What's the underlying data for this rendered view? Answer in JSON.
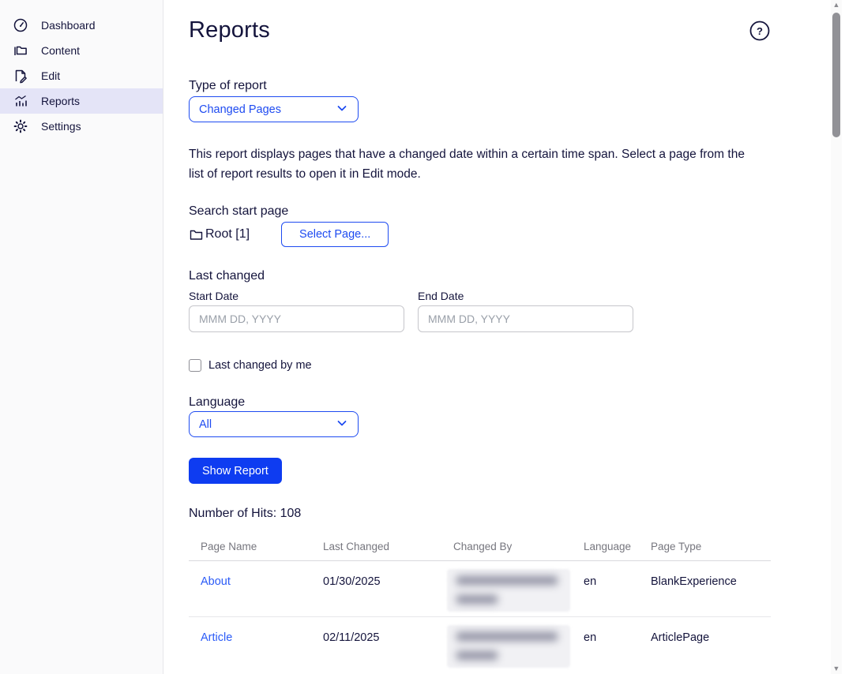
{
  "sidebar": {
    "items": [
      {
        "label": "Dashboard",
        "icon": "dashboard-gauge-icon",
        "selected": false
      },
      {
        "label": "Content",
        "icon": "content-folder-icon",
        "selected": false
      },
      {
        "label": "Edit",
        "icon": "edit-pencil-icon",
        "selected": false
      },
      {
        "label": "Reports",
        "icon": "reports-chart-icon",
        "selected": true
      },
      {
        "label": "Settings",
        "icon": "settings-gear-icon",
        "selected": false
      }
    ]
  },
  "header": {
    "title": "Reports",
    "help_icon": "help-circle-icon"
  },
  "form": {
    "type_of_report": {
      "label": "Type of report",
      "value": "Changed Pages"
    },
    "description": "This report displays pages that have a changed date within a certain time span. Select a page from the list of report results to open it in Edit mode.",
    "search_start_page": {
      "label": "Search start page",
      "root_icon": "folder-icon",
      "root_label": "Root [1]",
      "select_page_button": "Select Page..."
    },
    "last_changed": {
      "label": "Last changed",
      "start_date": {
        "label": "Start Date",
        "placeholder": "MMM DD, YYYY",
        "value": ""
      },
      "end_date": {
        "label": "End Date",
        "placeholder": "MMM DD, YYYY",
        "value": ""
      },
      "by_me_checkbox": {
        "label": "Last changed by me",
        "checked": false
      }
    },
    "language": {
      "label": "Language",
      "value": "All"
    },
    "show_report_button": "Show Report"
  },
  "results": {
    "hits_label": "Number of Hits: 108",
    "table": {
      "columns": [
        "Page Name",
        "Last Changed",
        "Changed By",
        "Language",
        "Page Type"
      ],
      "rows": [
        {
          "page_name": "About",
          "last_changed": "01/30/2025",
          "changed_by_redacted": true,
          "language": "en",
          "page_type": "BlankExperience"
        },
        {
          "page_name": "Article",
          "last_changed": "02/11/2025",
          "changed_by_redacted": true,
          "language": "en",
          "page_type": "ArticlePage"
        }
      ]
    }
  },
  "colors": {
    "accent_blue": "#1E4BF1",
    "button_blue": "#0E3CF1",
    "link_blue": "#2B5BF7",
    "heading_navy": "#14143C",
    "selected_item_bg": "#E4E4F7",
    "sidebar_bg": "#FAFAFB",
    "table_header_gray": "#76767E"
  }
}
